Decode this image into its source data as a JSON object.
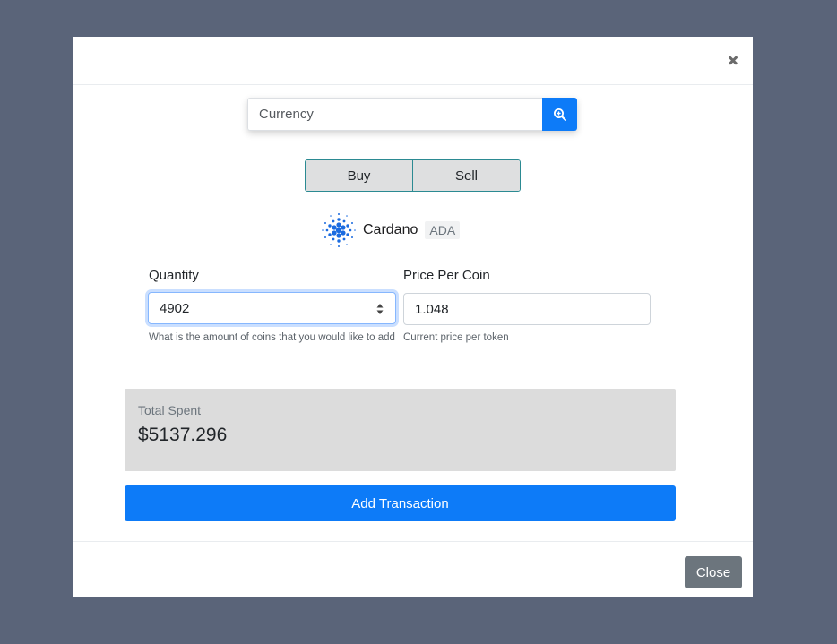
{
  "search": {
    "placeholder": "Currency",
    "icon": "search-icon"
  },
  "toggle": {
    "buy_label": "Buy",
    "sell_label": "Sell"
  },
  "coin": {
    "name": "Cardano",
    "symbol": "ADA",
    "logo_color": "#1a6be0"
  },
  "quantity": {
    "label": "Quantity",
    "value": "4902",
    "help": "What is the amount of coins that you would like to add"
  },
  "price": {
    "label": "Price Per Coin",
    "value": "1.048",
    "help": "Current price per token"
  },
  "total": {
    "label": "Total Spent",
    "value": "$5137.296"
  },
  "actions": {
    "add_label": "Add Transaction",
    "close_label": "Close"
  },
  "colors": {
    "primary": "#0d7bf8",
    "secondary": "#6c757d",
    "toggle_border": "#2b8a92",
    "backdrop": "#5a6479"
  }
}
